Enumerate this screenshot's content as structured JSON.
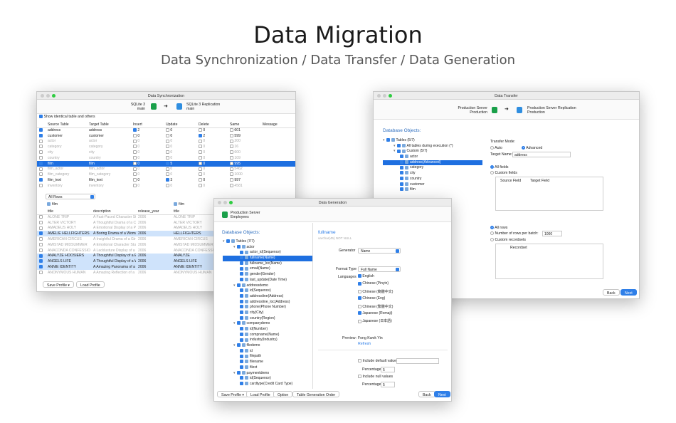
{
  "hero": {
    "title": "Data Migration",
    "subtitle": "Data Synchronization / Data Transfer / Data Generation"
  },
  "sync": {
    "title": "Data Synchronization",
    "source": "SQLite 3",
    "source_sub": "main",
    "target": "SQLite 3 Replication",
    "target_sub": "main",
    "show_identical": "Show identical table and others",
    "headers": [
      "Source Table",
      "Target Table",
      "Insert",
      "Update",
      "Delete",
      "Same",
      "Message"
    ],
    "rows": [
      {
        "s": "address",
        "t": "address",
        "i": "2",
        "u": "0",
        "d": "0",
        "same": "601",
        "on": true,
        "ic": true
      },
      {
        "s": "customer",
        "t": "customer",
        "i": "0",
        "u": "0",
        "d": "2",
        "same": "599",
        "on": true,
        "dc": true
      },
      {
        "s": "actor",
        "t": "actor",
        "i": "0",
        "u": "0",
        "d": "0",
        "same": "200",
        "grey": true
      },
      {
        "s": "category",
        "t": "category",
        "i": "0",
        "u": "0",
        "d": "0",
        "same": "16",
        "grey": true
      },
      {
        "s": "city",
        "t": "city",
        "i": "0",
        "u": "0",
        "d": "0",
        "same": "600",
        "grey": true
      },
      {
        "s": "country",
        "t": "country",
        "i": "0",
        "u": "0",
        "d": "0",
        "same": "109",
        "grey": true
      },
      {
        "s": "film",
        "t": "film",
        "i": "0",
        "u": "5",
        "d": "0",
        "same": "995",
        "sel": true
      },
      {
        "s": "film_actor",
        "t": "film_actor",
        "i": "0",
        "u": "0",
        "d": "0",
        "same": "5462",
        "grey": true
      },
      {
        "s": "film_category",
        "t": "film_category",
        "i": "0",
        "u": "0",
        "d": "0",
        "same": "1000",
        "grey": true
      },
      {
        "s": "film_text",
        "t": "film_text",
        "i": "0",
        "u": "3",
        "d": "0",
        "same": "997",
        "on": true,
        "uc": true
      },
      {
        "s": "inventory",
        "t": "inventory",
        "i": "0",
        "u": "0",
        "d": "0",
        "same": "4581",
        "grey": true
      }
    ],
    "filter": "All Rows",
    "left_table": "film",
    "right_table": "film",
    "detail_headers": [
      "title",
      "description",
      "release_year"
    ],
    "right_header": "title",
    "detail_rows": [
      {
        "t": "ALONE TRIP",
        "d": "A Fast-Paced Character Stud",
        "y": "2006",
        "g": true
      },
      {
        "t": "ALTER VICTORY",
        "d": "A Thoughtful Drama of a Co",
        "y": "2006",
        "g": true
      },
      {
        "t": "AMADEUS HOLY",
        "d": "A Emotional Display of a Pio",
        "y": "2006",
        "g": true
      },
      {
        "t": "AMELIE HELLFIGHTERS",
        "d": "A Boring Drama of a Woma",
        "y": "2006",
        "h": true,
        "r": "HELLFIGHTERS"
      },
      {
        "t": "AMERICAN CIRCUS",
        "d": "A Insightful Drama of a Girl",
        "y": "2006",
        "g": true
      },
      {
        "t": "AMISTAD MIDSUMMER",
        "d": "A Emotional Character Stud",
        "y": "2006",
        "g": true
      },
      {
        "t": "ANACONDA CONFESSIO",
        "d": "A Lacklusture Display of a D",
        "y": "2006",
        "g": true
      },
      {
        "t": "ANALYZE HOOSIERS",
        "d": "A Thoughtful Display of a E",
        "y": "2006",
        "h": true,
        "r": "ANALYZE"
      },
      {
        "t": "ANGELS LIFE",
        "d": "A Thoughtful Display of a W",
        "y": "2006",
        "h": true,
        "r": "ANGELS LIFE"
      },
      {
        "t": "ANNIE IDENTITY",
        "d": "A Amazing Panorama of a P",
        "y": "2006",
        "h": true,
        "r": "ANNIE IDENTITY"
      },
      {
        "t": "ANONYMOUS HUMAN",
        "d": "A Amazing Reflection of a",
        "y": "2006",
        "g": true
      }
    ],
    "save_profile": "Save Profile",
    "load_profile": "Load Profile"
  },
  "transfer": {
    "title": "Data Transfer",
    "source": "Production Server",
    "source_sub": "Production",
    "target": "Production Server Replication",
    "target_sub": "Production",
    "objects_label": "Database Objects:",
    "tree": [
      {
        "t": "Tables (5/7)",
        "lv": 0
      },
      {
        "t": "All tables during execution (*)",
        "lv": 1
      },
      {
        "t": "Custom (5/7)",
        "lv": 1
      },
      {
        "t": "actor",
        "lv": 2
      },
      {
        "t": "address(Advanced)",
        "lv": 2,
        "sel": true
      },
      {
        "t": "category",
        "lv": 2
      },
      {
        "t": "city",
        "lv": 2
      },
      {
        "t": "country",
        "lv": 2
      },
      {
        "t": "customer",
        "lv": 2
      },
      {
        "t": "film",
        "lv": 2
      }
    ],
    "transfer_mode": "Transfer Mode:",
    "auto": "Auto",
    "advanced": "Advanced",
    "target_name_label": "Target Name:",
    "target_name": "address",
    "all_fields": "All fields",
    "custom_fields": "Custom fields",
    "source_field": "Source Field",
    "target_field": "Target Field",
    "all_rows": "All rows",
    "rows_per_batch": "Number of rows per batch:",
    "batch": "1000",
    "custom_recordsets": "Custom recordsets",
    "recordset": "Recordset",
    "back": "Back",
    "next": "Next"
  },
  "gen": {
    "title": "Data Generation",
    "server": "Production Server",
    "db": "Employees",
    "objects_label": "Database Objects:",
    "tree": [
      {
        "t": "Tables (7/7)",
        "lv": 0
      },
      {
        "t": "actor",
        "lv": 1
      },
      {
        "t": "actor_id(Sequence)",
        "lv": 2
      },
      {
        "t": "fullname(Name)",
        "lv": 2,
        "sel": true
      },
      {
        "t": "fullname_loc(Name)",
        "lv": 2
      },
      {
        "t": "email(Name)",
        "lv": 2
      },
      {
        "t": "gender(Gender)",
        "lv": 2
      },
      {
        "t": "last_update(Date Time)",
        "lv": 2
      },
      {
        "t": "addressdemo",
        "lv": 1
      },
      {
        "t": "id(Sequence)",
        "lv": 2
      },
      {
        "t": "addressline(Address)",
        "lv": 2
      },
      {
        "t": "addressline_loc(Address)",
        "lv": 2
      },
      {
        "t": "phone(Phone Number)",
        "lv": 2
      },
      {
        "t": "city(City)",
        "lv": 2
      },
      {
        "t": "country(Region)",
        "lv": 2
      },
      {
        "t": "companydemo",
        "lv": 1
      },
      {
        "t": "id(Number)",
        "lv": 2
      },
      {
        "t": "compname(Name)",
        "lv": 2
      },
      {
        "t": "industry(Industry)",
        "lv": 2
      },
      {
        "t": "filedemo",
        "lv": 1
      },
      {
        "t": "id",
        "lv": 2
      },
      {
        "t": "filepath",
        "lv": 2
      },
      {
        "t": "filename",
        "lv": 2
      },
      {
        "t": "filext",
        "lv": 2
      },
      {
        "t": "paymentdemo",
        "lv": 1
      },
      {
        "t": "id(Sequence)",
        "lv": 2
      },
      {
        "t": "cardtype(Credit Card Type)",
        "lv": 2
      }
    ],
    "field_title": "fullname",
    "field_type": "varchar(45) NOT NULL",
    "generator_label": "Generator",
    "generator": "Name",
    "format_label": "Format Type",
    "format": "Full Name",
    "languages_label": "Languages",
    "langs": [
      {
        "t": "English",
        "on": true
      },
      {
        "t": "Chinese (Pinyin)",
        "on": true
      },
      {
        "t": "Chinese (簡體中文)",
        "on": false
      },
      {
        "t": "Chinese (Eng)",
        "on": true
      },
      {
        "t": "Chinese (繁體中文)",
        "on": false
      },
      {
        "t": "Japanese (Romaji)",
        "on": true
      },
      {
        "t": "Japanese (日本語)",
        "on": false
      }
    ],
    "preview_label": "Preview:",
    "preview": "Fong Kwok Yin",
    "refresh": "Refresh",
    "include_default": "Include default values",
    "percentage": "Percentage",
    "pct": "5",
    "include_null": "Include null values",
    "pct2": "5",
    "save_profile": "Save Profile",
    "load_profile": "Load Profile",
    "option": "Option",
    "table_order": "Table Generation Order",
    "back": "Back",
    "next": "Next"
  }
}
